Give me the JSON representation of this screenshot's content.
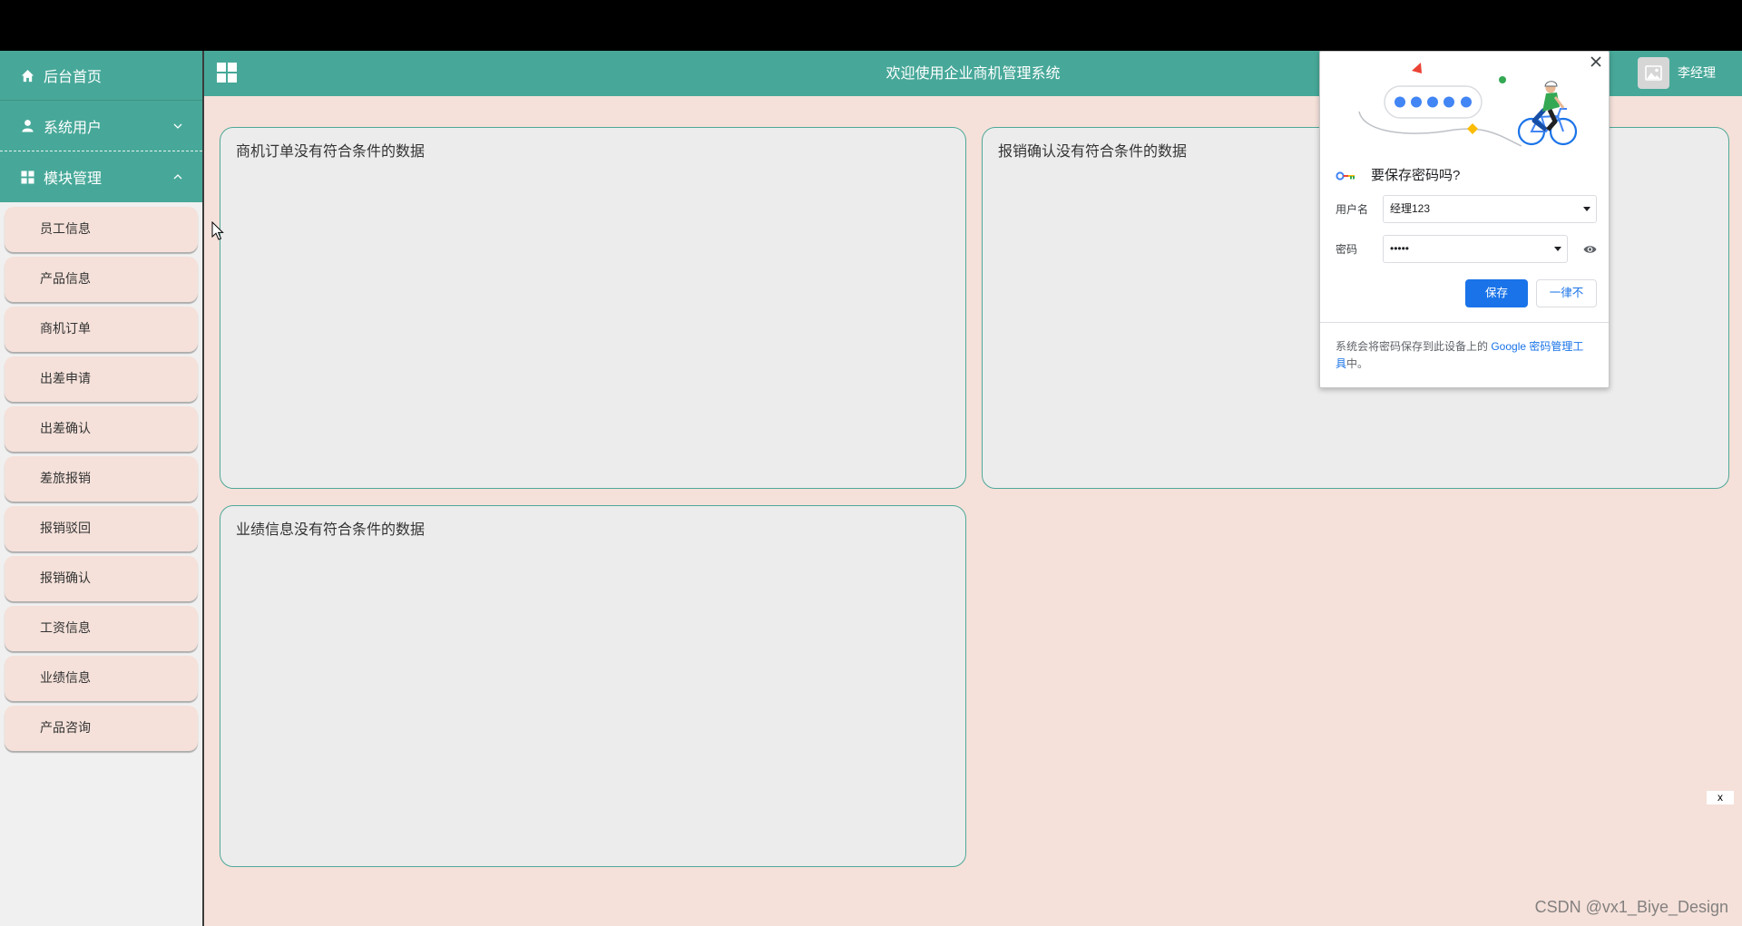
{
  "header": {
    "title": "欢迎使用企业商机管理系统",
    "username": "李经理",
    "menu_toggle_icon": "grid-icon",
    "avatar_icon": "image-placeholder-icon"
  },
  "sidebar": {
    "menu": [
      {
        "label": "后台首页",
        "icon": "home-icon"
      },
      {
        "label": "系统用户",
        "icon": "user-icon",
        "expanded": false
      },
      {
        "label": "模块管理",
        "icon": "grid-icon",
        "expanded": true
      }
    ],
    "submenu": [
      {
        "label": "员工信息"
      },
      {
        "label": "产品信息"
      },
      {
        "label": "商机订单"
      },
      {
        "label": "出差申请"
      },
      {
        "label": "出差确认"
      },
      {
        "label": "差旅报销"
      },
      {
        "label": "报销驳回"
      },
      {
        "label": "报销确认"
      },
      {
        "label": "工资信息"
      },
      {
        "label": "业绩信息"
      },
      {
        "label": "产品咨询"
      }
    ]
  },
  "panels": [
    {
      "message": "商机订单没有符合条件的数据"
    },
    {
      "message": "报销确认没有符合条件的数据"
    },
    {
      "message": "业绩信息没有符合条件的数据"
    }
  ],
  "save_password_dialog": {
    "title": "要保存密码吗?",
    "username_label": "用户名",
    "username_value": "经理123",
    "password_label": "密码",
    "password_value": "•••••",
    "save_label": "保存",
    "never_label": "一律不",
    "footer_prefix": "系统会将密码保存到此设备上的 ",
    "footer_link": "Google 密码管理工具",
    "footer_suffix": "中。",
    "close_icon": "close-icon",
    "reveal_icon": "eye-icon"
  },
  "floating_close_label": "x",
  "watermark": "CSDN @vx1_Biye_Design",
  "colors": {
    "accent": "#47a899",
    "page_background": "#f5e1da",
    "panel_background": "#ececec",
    "sidebar_background": "#f0f0f0",
    "primary_button": "#1a73e8"
  }
}
